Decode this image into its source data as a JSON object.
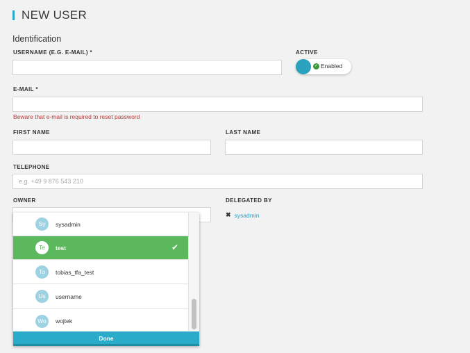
{
  "header": {
    "title": "NEW USER"
  },
  "identification": {
    "title": "Identification"
  },
  "form": {
    "username_label": "USERNAME (E.G. E-MAIL) *",
    "active_label": "ACTIVE",
    "active_state": "Enabled",
    "email_label": "E-MAIL *",
    "email_warning": "Beware that e-mail is required to reset password",
    "first_name_label": "FIRST NAME",
    "last_name_label": "LAST NAME",
    "telephone_label": "TELEPHONE",
    "telephone_placeholder": "e.g. +49 9 876 543 210",
    "owner_label": "OWNER",
    "delegated_label": "DELEGATED BY",
    "delegated_user": "sysadmin"
  },
  "owner_dropdown": {
    "items": [
      {
        "initials": "Sy",
        "name": "sysadmin",
        "selected": false
      },
      {
        "initials": "Te",
        "name": "test",
        "selected": true
      },
      {
        "initials": "To",
        "name": "tobias_tfa_test",
        "selected": false
      },
      {
        "initials": "Us",
        "name": "username",
        "selected": false
      },
      {
        "initials": "Wo",
        "name": "wojtek",
        "selected": false
      }
    ],
    "done_label": "Done"
  },
  "colors": {
    "accent": "#29a7c8",
    "selected": "#5cb85c",
    "warning": "#b33a3a"
  }
}
